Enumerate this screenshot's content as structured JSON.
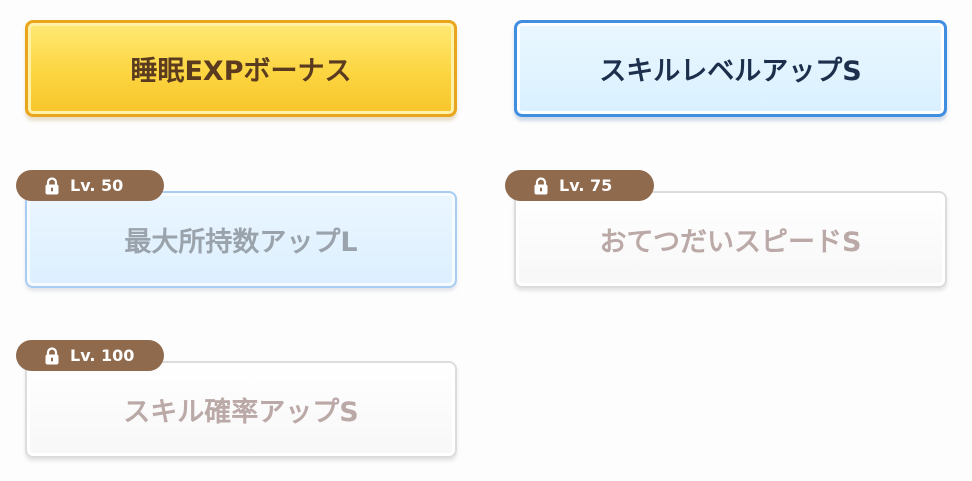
{
  "skills": [
    {
      "label": "睡眠EXPボーナス",
      "state": "active",
      "color": "#fcd540"
    },
    {
      "label": "スキルレベルアップS",
      "state": "active",
      "color": "#d9f0ff"
    },
    {
      "label": "最大所持数アップL",
      "state": "locked",
      "level": "Lv. 50",
      "color": "#dcefff"
    },
    {
      "label": "おてつだいスピードS",
      "state": "locked",
      "level": "Lv. 75",
      "color": "#f7f7f7"
    },
    {
      "label": "スキル確率アップS",
      "state": "locked",
      "level": "Lv. 100",
      "color": "#f7f7f7"
    }
  ],
  "lock_tag": {
    "color": "#8f6a4d",
    "icon": "lock-icon"
  }
}
